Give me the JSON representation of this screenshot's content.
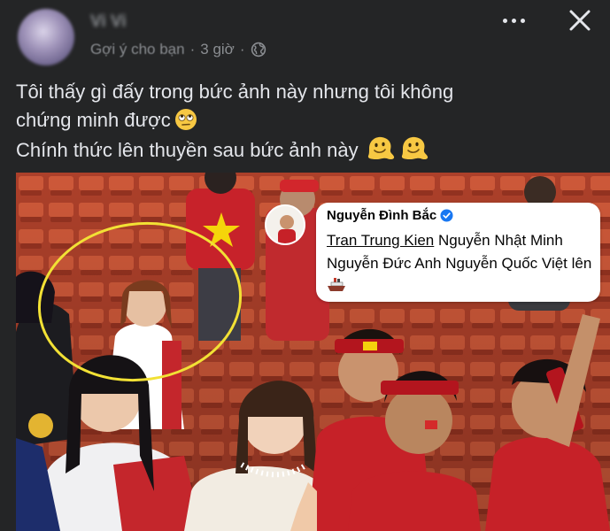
{
  "post": {
    "author_name": "Vi Vi",
    "suggestion": "Gợi ý cho bạn",
    "separator": "·",
    "time": "3 giờ",
    "privacy_icon": "globe-icon",
    "more_icon": "more-options-icon",
    "close_icon": "close-icon"
  },
  "caption": {
    "line1": "Tôi thấy gì đấy trong bức ảnh này nhưng tôi không",
    "line2": "chứng minh được",
    "line3": "Chính thức lên thuyền sau bức ảnh này",
    "emoji_line2": "face-with-rolling-eyes-emoji",
    "emoji_line3": "melting-face-emoji"
  },
  "photo": {
    "highlight_color": "#f2e135",
    "comment_overlay": {
      "name": "Nguyễn Đình Bắc",
      "verified_icon": "verified-badge-icon",
      "tagged": "Tran Trung Kien",
      "text": "Nguyễn Nhật Minh Nguyễn Đức Anh Nguyễn Quốc Việt lên",
      "emoji": "ship-emoji"
    }
  },
  "colors": {
    "background": "#242526",
    "text_primary": "#e4e6eb",
    "text_secondary": "#8a8d91",
    "verified": "#1877f2"
  }
}
